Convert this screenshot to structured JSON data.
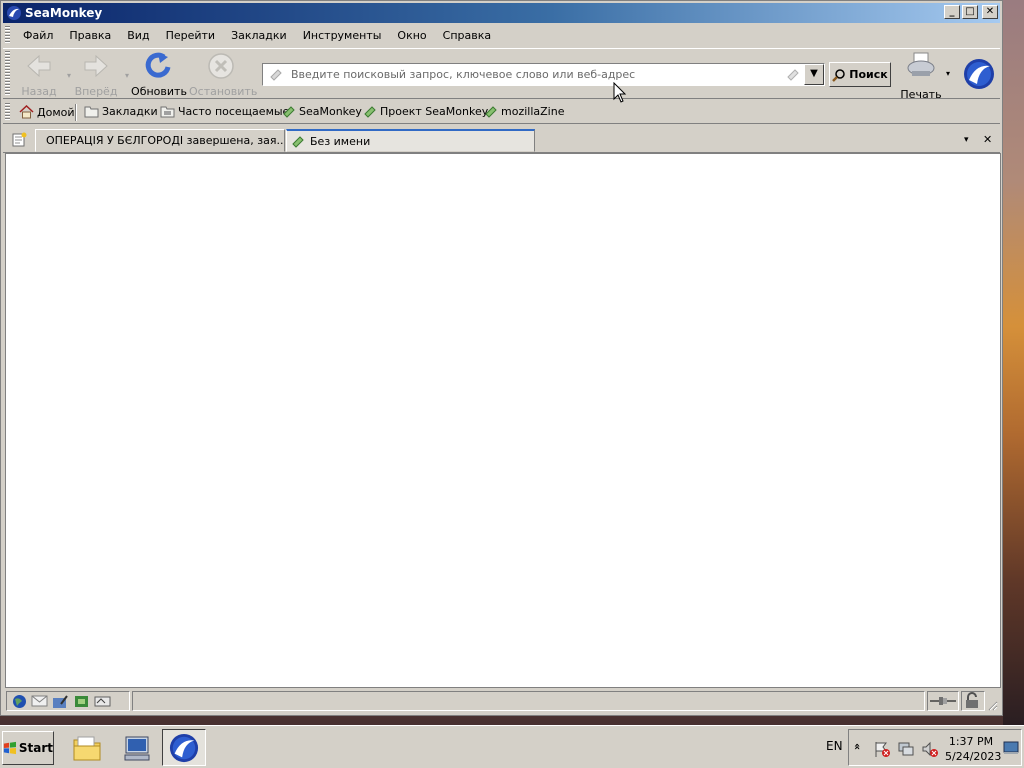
{
  "window": {
    "title": "SeaMonkey",
    "controls": [
      "_",
      "□",
      "✕"
    ]
  },
  "menu": [
    "Файл",
    "Правка",
    "Вид",
    "Перейти",
    "Закладки",
    "Инструменты",
    "Окно",
    "Справка"
  ],
  "nav": {
    "back": "Назад",
    "forward": "Вперёд",
    "reload": "Обновить",
    "stop": "Остановить",
    "url_placeholder": "Введите поисковый запрос, ключевое слово или веб-адрес",
    "search": "Поиск",
    "print": "Печать"
  },
  "bookmarks": [
    "Домой",
    "Закладки",
    "Часто посещаемые",
    "SeaMonkey",
    "Проект SeaMonkey",
    "mozillaZine"
  ],
  "tabs": [
    {
      "label": "ОПЕРАЦІЯ У БЄЛГОРОДІ завершена, зая..."
    },
    {
      "label": "Без имени"
    }
  ],
  "tab_controls": {
    "list": "▾",
    "close": "✕"
  },
  "taskbar": {
    "start": "Start",
    "lang": "EN",
    "time": "1:37 PM",
    "date": "5/24/2023",
    "tray_expand": "«"
  }
}
